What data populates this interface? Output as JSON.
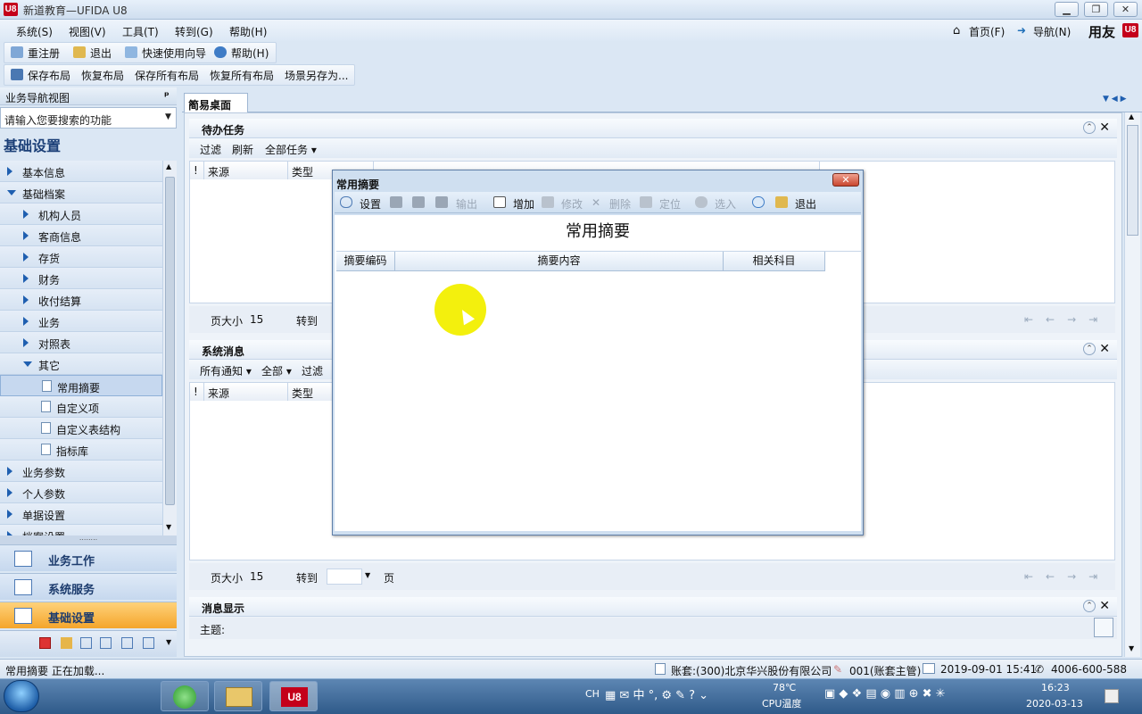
{
  "window": {
    "title": "新道教育—UFIDA U8",
    "logo": "U8",
    "controls": [
      "minimize",
      "restore",
      "close"
    ]
  },
  "menubar": {
    "items": [
      "系统(S)",
      "视图(V)",
      "工具(T)",
      "转到(G)",
      "帮助(H)"
    ],
    "home": "首页(F)",
    "navigate": "导航(N)",
    "brand": "用友",
    "brand_mark": "U8"
  },
  "toolbar1": {
    "items": [
      "重注册",
      "退出",
      "快速使用向导",
      "帮助(H)"
    ]
  },
  "toolbar2": {
    "items": [
      "保存布局",
      "恢复布局",
      "保存所有布局",
      "恢复所有布局",
      "场景另存为..."
    ]
  },
  "nav": {
    "header": "业务导航视图",
    "pin": "ᵖ",
    "search_placeholder": "请输入您要搜索的功能",
    "title": "基础设置",
    "tree": [
      {
        "label": "基本信息",
        "level": 0,
        "state": "collapsed"
      },
      {
        "label": "基础档案",
        "level": 0,
        "state": "expanded"
      },
      {
        "label": "机构人员",
        "level": 1,
        "state": "collapsed"
      },
      {
        "label": "客商信息",
        "level": 1,
        "state": "collapsed"
      },
      {
        "label": "存货",
        "level": 1,
        "state": "collapsed"
      },
      {
        "label": "财务",
        "level": 1,
        "state": "collapsed"
      },
      {
        "label": "收付结算",
        "level": 1,
        "state": "collapsed"
      },
      {
        "label": "业务",
        "level": 1,
        "state": "collapsed"
      },
      {
        "label": "对照表",
        "level": 1,
        "state": "collapsed"
      },
      {
        "label": "其它",
        "level": 1,
        "state": "expanded"
      },
      {
        "label": "常用摘要",
        "level": 2,
        "state": "leaf",
        "selected": true
      },
      {
        "label": "自定义项",
        "level": 2,
        "state": "leaf"
      },
      {
        "label": "自定义表结构",
        "level": 2,
        "state": "leaf"
      },
      {
        "label": "指标库",
        "level": 2,
        "state": "leaf"
      },
      {
        "label": "业务参数",
        "level": 0,
        "state": "collapsed"
      },
      {
        "label": "个人参数",
        "level": 0,
        "state": "collapsed"
      },
      {
        "label": "单据设置",
        "level": 0,
        "state": "collapsed"
      },
      {
        "label": "档案设置",
        "level": 0,
        "state": "collapsed"
      }
    ],
    "big_items": [
      {
        "label": "业务工作",
        "active": false
      },
      {
        "label": "系统服务",
        "active": false
      },
      {
        "label": "基础设置",
        "active": true
      }
    ]
  },
  "tabs": [
    {
      "label": "简易桌面",
      "close": "✕"
    }
  ],
  "todo": {
    "title": "待办任务",
    "tools": [
      "过滤",
      "刷新",
      "全部任务 ▾"
    ],
    "columns": [
      "!",
      "来源",
      "类型"
    ],
    "page_size_label": "页大小",
    "page_size": "15",
    "goto_label": "转到"
  },
  "sysmsg": {
    "title": "系统消息",
    "tools": [
      "所有通知 ▾",
      "全部 ▾",
      "过滤"
    ],
    "columns": [
      "!",
      "来源",
      "类型"
    ],
    "page_size_label": "页大小",
    "page_size": "15",
    "goto_label": "转到",
    "page_label": "页"
  },
  "msgdisplay": {
    "title": "消息显示",
    "subject_label": "主题:"
  },
  "dialog": {
    "title": "常用摘要",
    "heading": "常用摘要",
    "toolbar": [
      {
        "label": "设置",
        "enabled": true
      },
      {
        "label": "输出",
        "enabled": false
      },
      {
        "label": "增加",
        "enabled": true
      },
      {
        "label": "修改",
        "enabled": false
      },
      {
        "label": "删除",
        "enabled": false
      },
      {
        "label": "定位",
        "enabled": false
      },
      {
        "label": "选入",
        "enabled": false
      },
      {
        "label": "退出",
        "enabled": true
      }
    ],
    "columns": [
      "摘要编码",
      "摘要内容",
      "相关科目"
    ]
  },
  "statusbar": {
    "message": "常用摘要 正在加载...",
    "account": "账套:(300)北京华兴股份有限公司",
    "user": "001(账套主管)",
    "datetime": "2019-09-01 15:41",
    "phone": "4006-600-588"
  },
  "taskbar": {
    "lang": "CH",
    "temp": "78℃",
    "temp_label": "CPU温度",
    "time": "16:23",
    "date": "2020-03-13"
  }
}
